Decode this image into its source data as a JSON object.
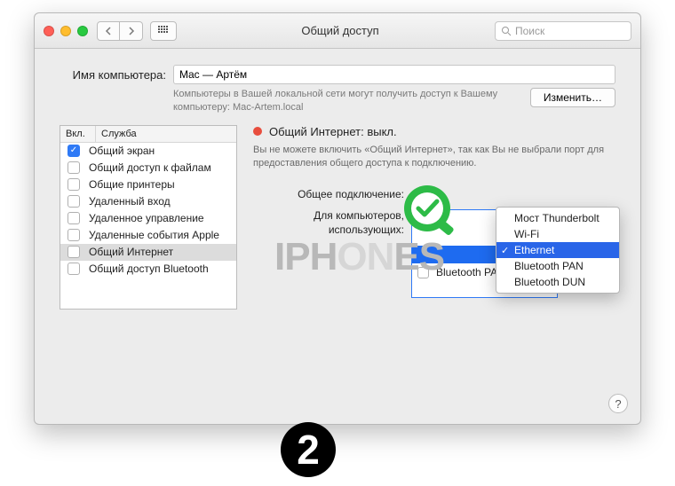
{
  "window": {
    "title": "Общий доступ",
    "search_placeholder": "Поиск"
  },
  "computer_name": {
    "label": "Имя компьютера:",
    "value": "Mac — Артём",
    "hint": "Компьютеры в Вашей локальной сети могут получить доступ к Вашему компьютеру: Mac-Artem.local",
    "edit_button": "Изменить…"
  },
  "services": {
    "col_enabled": "Вкл.",
    "col_service": "Служба",
    "items": [
      {
        "label": "Общий экран",
        "on": true,
        "selected": false
      },
      {
        "label": "Общий доступ к файлам",
        "on": false,
        "selected": false
      },
      {
        "label": "Общие принтеры",
        "on": false,
        "selected": false
      },
      {
        "label": "Удаленный вход",
        "on": false,
        "selected": false
      },
      {
        "label": "Удаленное управление",
        "on": false,
        "selected": false
      },
      {
        "label": "Удаленные события Apple",
        "on": false,
        "selected": false
      },
      {
        "label": "Общий Интернет",
        "on": false,
        "selected": true
      },
      {
        "label": "Общий доступ Bluetooth",
        "on": false,
        "selected": false
      }
    ]
  },
  "detail": {
    "status_title": "Общий Интернет: выкл.",
    "status_desc": "Вы не можете включить «Общий Интернет», так как Вы не выбрали порт для предоставления общего доступа к подключению.",
    "share_from_label": "Общее подключение:",
    "ports_label_1": "Для компьютеров,",
    "ports_label_2": "использующих:",
    "port_rows": [
      {
        "label": "Bluetooth PAN",
        "selected": true
      }
    ]
  },
  "dropdown": {
    "items": [
      {
        "label": "Мост Thunderbolt",
        "selected": false
      },
      {
        "label": "Wi-Fi",
        "selected": false
      },
      {
        "label": "Ethernet",
        "selected": true
      },
      {
        "label": "Bluetooth PAN",
        "selected": false
      },
      {
        "label": "Bluetooth DUN",
        "selected": false
      }
    ]
  },
  "watermark": {
    "pre": "IPH",
    "obs": "ON",
    "post": "ES"
  },
  "step_badge": "2"
}
